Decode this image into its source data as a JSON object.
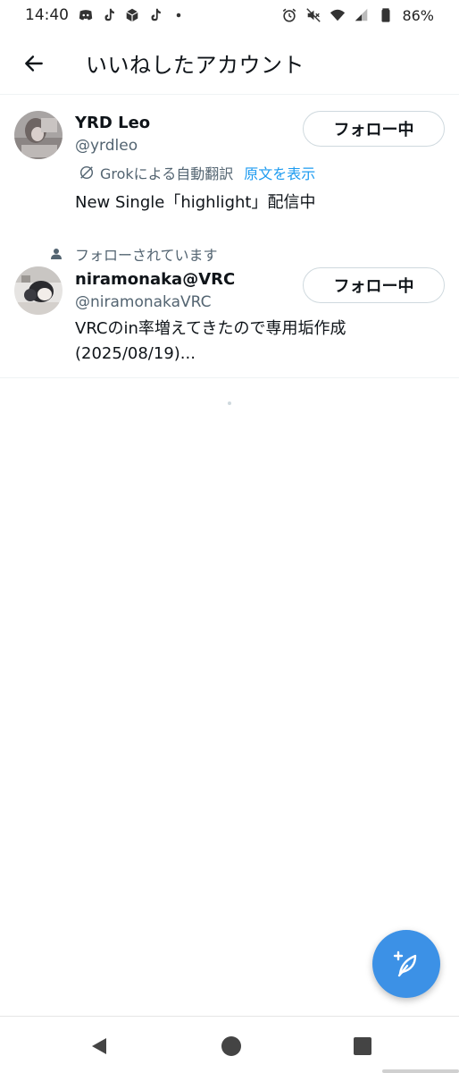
{
  "status_bar": {
    "time": "14:40",
    "battery": "86%"
  },
  "header": {
    "title": "いいねしたアカウント"
  },
  "users": [
    {
      "name": "YRD Leo",
      "handle": "@yrdleo",
      "follow_label": "フォロー中",
      "translation": {
        "text": "Grokによる自動翻訳",
        "link": "原文を表示"
      },
      "bio": "New Single「highlight」配信中"
    },
    {
      "follows_you": "フォローされています",
      "name": "niramonaka@VRC",
      "handle": "@niramonakaVRC",
      "follow_label": "フォロー中",
      "bio_line1": "VRCのin率増えてきたので専用垢作成",
      "bio_line2": "(2025/08/19)..."
    }
  ],
  "colors": {
    "accent": "#1d9bf0",
    "fab": "#3c91e6",
    "secondary_text": "#536471"
  }
}
